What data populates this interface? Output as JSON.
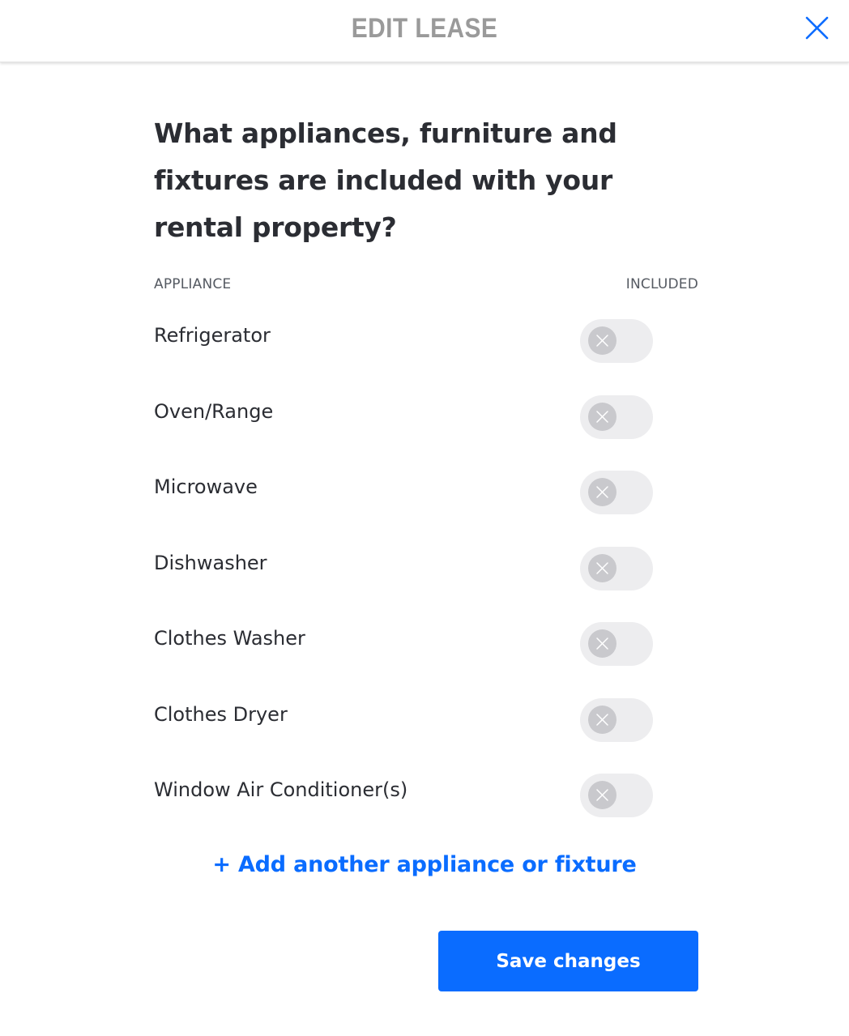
{
  "header": {
    "title": "EDIT LEASE",
    "close_icon": "close-icon"
  },
  "question": "What appliances, furniture and fixtures are included with your rental property?",
  "columns": {
    "appliance": "APPLIANCE",
    "included": "INCLUDED"
  },
  "appliances": [
    {
      "label": "Refrigerator",
      "included": false
    },
    {
      "label": "Oven/Range",
      "included": false
    },
    {
      "label": "Microwave",
      "included": false
    },
    {
      "label": "Dishwasher",
      "included": false
    },
    {
      "label": "Clothes Washer",
      "included": false
    },
    {
      "label": "Clothes Dryer",
      "included": false
    },
    {
      "label": "Window Air Conditioner(s)",
      "included": false
    }
  ],
  "add_link": "+ Add another appliance or fixture",
  "save_button": "Save changes",
  "colors": {
    "accent": "#0a6cff",
    "title_gray": "#9a9a9a",
    "toggle_track": "#ededef",
    "toggle_knob": "#c9c9cd"
  }
}
